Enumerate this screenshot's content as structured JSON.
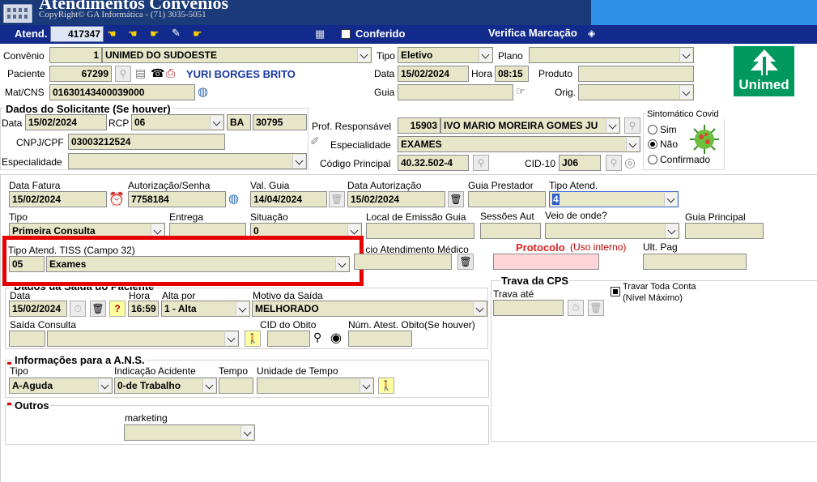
{
  "header": {
    "title": "Atendimentos Convênios",
    "copyright": "CopyRight© GA Informática - (71) 3035-5051"
  },
  "toolbar": {
    "atend_label": "Atend.",
    "atend_value": "417347",
    "conferido_label": "Conferido",
    "verifica_label": "Verifica Marcação"
  },
  "top": {
    "convenio_label": "Convênio",
    "convenio_code": "1",
    "convenio_name": "UNIMED DO SUDOESTE",
    "tipo_label": "Tipo",
    "tipo_value": "Eletivo",
    "plano_label": "Plano",
    "paciente_label": "Paciente",
    "paciente_code": "67299",
    "paciente_name": "YURI BORGES BRITO",
    "data_label": "Data",
    "data_value": "15/02/2024",
    "hora_label": "Hora",
    "hora_value": "08:15",
    "produto_label": "Produto",
    "matcns_label": "Mat/CNS",
    "matcns_value": "01630143400039000",
    "guia_label": "Guia",
    "orig_label": "Orig.",
    "logo_text": "Unimed",
    "logo_color": "#00995d"
  },
  "solicitante": {
    "title": "Dados do Solicitante (Se houver)",
    "data_label": "Data",
    "data_value": "15/02/2024",
    "rcp_label": "RCP",
    "rcp_value": "06",
    "uf_value": "BA",
    "num_value": "30795",
    "cnpj_label": "CNPJ/CPF",
    "cnpj_value": "03003212524",
    "especialidade_label": "Especialidade",
    "prof_label": "Prof. Responsável",
    "prof_code": "15903",
    "prof_name": "IVO MARIO MOREIRA GOMES JU",
    "esp2_label": "Especialidade",
    "esp2_value": "EXAMES",
    "codigo_label": "Código Principal",
    "codigo_value": "40.32.502-4",
    "cid_label": "CID-10",
    "cid_value": "J06",
    "sint_title": "Sintomático Covid",
    "sint_options": [
      "Sim",
      "Não",
      "Confirmado"
    ]
  },
  "fatura": {
    "data_fatura_label": "Data Fatura",
    "data_fatura_value": "15/02/2024",
    "autorizacao_label": "Autorização/Senha",
    "autorizacao_value": "7758184",
    "val_guia_label": "Val. Guia",
    "val_guia_value": "14/04/2024",
    "data_aut_label": "Data Autorização",
    "data_aut_value": "15/02/2024",
    "guia_prestador_label": "Guia Prestador",
    "tipo_atend_label": "Tipo Atend.",
    "tipo_atend_value": "4",
    "tipo_label": "Tipo",
    "tipo_value": "Primeira Consulta",
    "entrega_label": "Entrega",
    "situacao_label": "Situação",
    "situacao_value": "0",
    "local_emissao_label": "Local de Emissão Guia",
    "sessoes_label": "Sessões Aut",
    "veio_label": "Veio de onde?",
    "guia_principal_label": "Guia Principal",
    "tiss_label": "Tipo Atend. TISS (Campo 32)",
    "tiss_code": "05",
    "tiss_value": "Exames",
    "inicio_label": "Início Atendimento Médico",
    "protocolo_label": "Protocolo",
    "protocolo_hint": "(Uso interno)",
    "ult_pag_label": "Ult. Pag"
  },
  "saida": {
    "title": "Dados da Saída do Paciente",
    "data_label": "Data",
    "data_value": "15/02/2024",
    "hora_label": "Hora",
    "hora_value": "16:59",
    "alta_label": "Alta por",
    "alta_value": "1 - Alta",
    "motivo_label": "Motivo da Saída",
    "motivo_value": "MELHORADO",
    "saida_consulta_label": "Saída Consulta",
    "cid_obito_label": "CID do Obito",
    "num_atest_label": "Núm. Atest. Obito(Se houver)"
  },
  "cps": {
    "title": "Trava da CPS",
    "trava_ate_label": "Trava até",
    "travar_label": "Travar Toda Conta",
    "nivel_label": "(Nível Máximo)"
  },
  "ans": {
    "title": "Informações para a A.N.S.",
    "tipo_label": "Tipo",
    "tipo_value": "A-Aguda",
    "acidente_label": "Indicação Acidente",
    "acidente_value": "0-de Trabalho",
    "tempo_label": "Tempo",
    "unidade_label": "Unidade de Tempo"
  },
  "outros": {
    "title": "Outros",
    "marketing_label": "marketing"
  }
}
